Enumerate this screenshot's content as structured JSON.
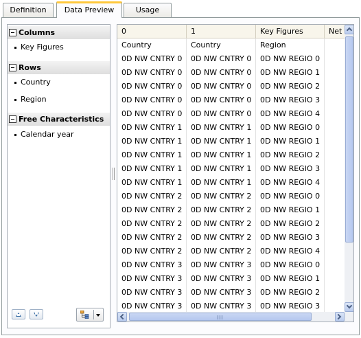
{
  "tabs": [
    {
      "label": "Definition",
      "active": false
    },
    {
      "label": "Data Preview",
      "active": true
    },
    {
      "label": "Usage",
      "active": false
    }
  ],
  "left_panel": {
    "sections": [
      {
        "title": "Columns",
        "items": [
          "Key Figures"
        ]
      },
      {
        "title": "Rows",
        "items": [
          "Country",
          "Region"
        ]
      },
      {
        "title": "Free Characteristics",
        "items": [
          "Calendar year"
        ]
      }
    ],
    "footer": {
      "move_up_icon": "triangle-up-icon",
      "move_down_icon": "triangle-down-icon",
      "hierarchy_icon": "hierarchy-icon"
    }
  },
  "grid": {
    "headers": [
      "0",
      "1",
      "Key Figures",
      "Net"
    ],
    "rows": [
      [
        "Country",
        "Country",
        "Region",
        ""
      ],
      [
        "0D NW CNTRY 0",
        "0D NW CNTRY 0",
        "0D NW REGIO 0",
        ""
      ],
      [
        "0D NW CNTRY 0",
        "0D NW CNTRY 0",
        "0D NW REGIO 1",
        ""
      ],
      [
        "0D NW CNTRY 0",
        "0D NW CNTRY 0",
        "0D NW REGIO 2",
        ""
      ],
      [
        "0D NW CNTRY 0",
        "0D NW CNTRY 0",
        "0D NW REGIO 3",
        ""
      ],
      [
        "0D NW CNTRY 0",
        "0D NW CNTRY 0",
        "0D NW REGIO 4",
        ""
      ],
      [
        "0D NW CNTRY 1",
        "0D NW CNTRY 1",
        "0D NW REGIO 0",
        ""
      ],
      [
        "0D NW CNTRY 1",
        "0D NW CNTRY 1",
        "0D NW REGIO 1",
        ""
      ],
      [
        "0D NW CNTRY 1",
        "0D NW CNTRY 1",
        "0D NW REGIO 2",
        ""
      ],
      [
        "0D NW CNTRY 1",
        "0D NW CNTRY 1",
        "0D NW REGIO 3",
        ""
      ],
      [
        "0D NW CNTRY 1",
        "0D NW CNTRY 1",
        "0D NW REGIO 4",
        ""
      ],
      [
        "0D NW CNTRY 2",
        "0D NW CNTRY 2",
        "0D NW REGIO 0",
        ""
      ],
      [
        "0D NW CNTRY 2",
        "0D NW CNTRY 2",
        "0D NW REGIO 1",
        ""
      ],
      [
        "0D NW CNTRY 2",
        "0D NW CNTRY 2",
        "0D NW REGIO 2",
        ""
      ],
      [
        "0D NW CNTRY 2",
        "0D NW CNTRY 2",
        "0D NW REGIO 3",
        ""
      ],
      [
        "0D NW CNTRY 2",
        "0D NW CNTRY 2",
        "0D NW REGIO 4",
        ""
      ],
      [
        "0D NW CNTRY 3",
        "0D NW CNTRY 3",
        "0D NW REGIO 0",
        ""
      ],
      [
        "0D NW CNTRY 3",
        "0D NW CNTRY 3",
        "0D NW REGIO 1",
        ""
      ],
      [
        "0D NW CNTRY 3",
        "0D NW CNTRY 3",
        "0D NW REGIO 2",
        ""
      ],
      [
        "0D NW CNTRY 3",
        "0D NW CNTRY 3",
        "0D NW REGIO 3",
        ""
      ]
    ]
  },
  "colors": {
    "active_tab_accent": "#ffc83c",
    "header_bg": "#f8f5eb",
    "scrollbar": "#b9cbee"
  }
}
